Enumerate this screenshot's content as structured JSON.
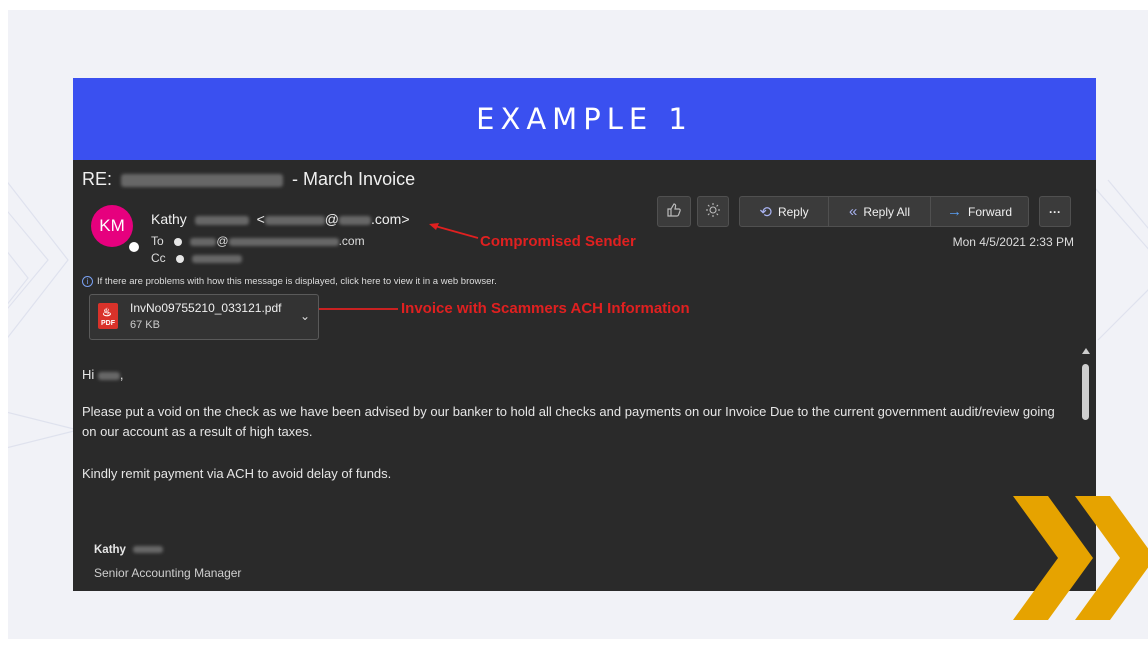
{
  "banner": {
    "title": "EXAMPLE 1"
  },
  "email": {
    "subject_prefix": "RE:",
    "subject_suffix": "- March Invoice",
    "avatar_initials": "KM",
    "sender_name": "Kathy",
    "sender_open": "<",
    "sender_at": "@",
    "sender_domain_end": ".com>",
    "to_label": "To",
    "to_at": "@",
    "to_domain_end": ".com",
    "cc_label": "Cc",
    "date": "Mon 4/5/2021 2:33 PM",
    "info_text": "If there are problems with how this message is displayed, click here to view it in a web browser.",
    "attachment": {
      "name": "InvNo09755210_033121.pdf",
      "size": "67 KB",
      "pdf_label": "PDF"
    },
    "body": {
      "greeting_prefix": "Hi",
      "greeting_suffix": ",",
      "paragraph1": "Please put a void on the check as we have been advised by our banker to hold all checks and payments on our Invoice Due to the current government audit/review going on our account as a result of high taxes.",
      "paragraph2": "Kindly remit payment via ACH to avoid delay of funds."
    },
    "signature": {
      "name": "Kathy",
      "title": "Senior Accounting Manager"
    }
  },
  "toolbar": {
    "reply_label": "Reply",
    "reply_all_label": "Reply All",
    "forward_label": "Forward",
    "more_label": "···",
    "icons": [
      "thumbs-up-icon",
      "sun-icon",
      "reply-icon",
      "reply-all-icon",
      "forward-arrow-icon",
      "more-icon"
    ]
  },
  "annotations": {
    "sender": "Compromised Sender",
    "attachment": "Invoice with Scammers ACH Information"
  },
  "colors": {
    "banner": "#3a50f0",
    "email_bg": "#2a2a2a",
    "avatar": "#e6007e",
    "annotation": "#e02020",
    "chevron": "#e6a300"
  }
}
